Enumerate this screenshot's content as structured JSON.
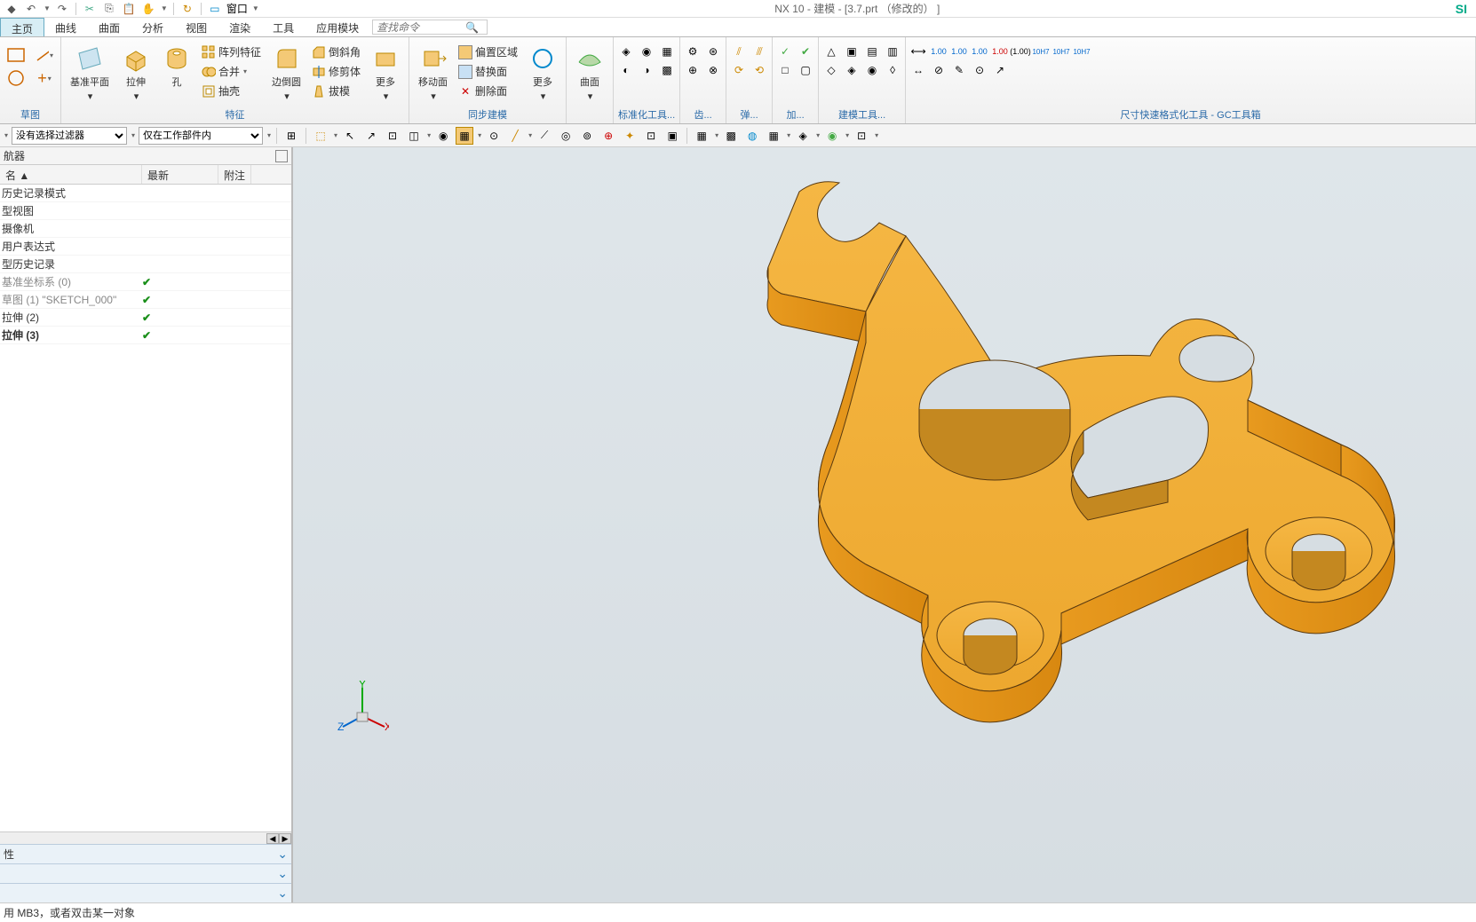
{
  "title": "NX 10 - 建模 - [3.7.prt  （修改的）  ]",
  "brand": "SI",
  "qat": {
    "window_label": "窗口"
  },
  "tabs": [
    "主页",
    "曲线",
    "曲面",
    "分析",
    "视图",
    "渲染",
    "工具",
    "应用模块"
  ],
  "active_tab": 0,
  "search_placeholder": "查找命令",
  "ribbon": {
    "g1": {
      "label": "草图",
      "btns": {
        "sketch_line": "",
        "sketch_circle": "",
        "sketch_plus": ""
      }
    },
    "g2": {
      "label": "特征",
      "datum": "基准平面",
      "extrude": "拉伸",
      "hole": "孔",
      "pattern": "阵列特征",
      "unite": "合并",
      "shell": "抽壳",
      "edge_blend": "边倒圆",
      "chamfer": "倒斜角",
      "trim": "修剪体",
      "draft": "拔模",
      "more": "更多"
    },
    "g3": {
      "label": "同步建模",
      "move_face": "移动面",
      "offset": "偏置区域",
      "replace": "替换面",
      "delete": "删除面",
      "more": "更多"
    },
    "g4": {
      "label": "",
      "surface": "曲面"
    },
    "g5": {
      "label": "标准化工具..."
    },
    "g6": {
      "label": "齿..."
    },
    "g7": {
      "label": "弹..."
    },
    "g8": {
      "label": "加..."
    },
    "g9": {
      "label": "建模工具..."
    },
    "g10": {
      "label": "尺寸快速格式化工具 - GC工具箱"
    }
  },
  "selbar": {
    "filter": "没有选择过滤器",
    "scope": "仅在工作部件内"
  },
  "nav": {
    "title": "航器",
    "cols": [
      "名 ▲",
      "最新",
      "附注"
    ],
    "rows": [
      {
        "label": "历史记录模式",
        "chk": "",
        "cls": ""
      },
      {
        "label": "型视图",
        "chk": "",
        "cls": ""
      },
      {
        "label": "摄像机",
        "chk": "",
        "cls": ""
      },
      {
        "label": "用户表达式",
        "chk": "",
        "cls": ""
      },
      {
        "label": "型历史记录",
        "chk": "",
        "cls": ""
      },
      {
        "label": "基准坐标系 (0)",
        "chk": "✔",
        "cls": "gray"
      },
      {
        "label": "草图 (1) \"SKETCH_000\"",
        "chk": "✔",
        "cls": "gray"
      },
      {
        "label": "拉伸 (2)",
        "chk": "✔",
        "cls": ""
      },
      {
        "label": "拉伸 (3)",
        "chk": "✔",
        "cls": "bold"
      }
    ],
    "panel": "性"
  },
  "status": "用 MB3，或者双击某一对象"
}
